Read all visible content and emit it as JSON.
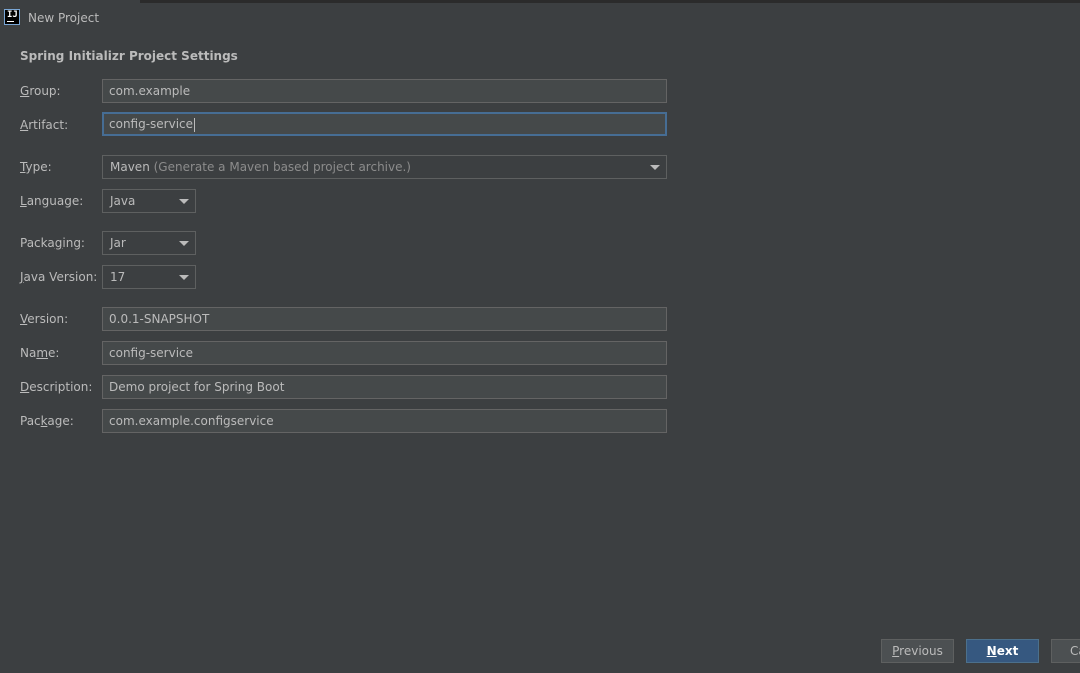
{
  "window": {
    "title": "New Project"
  },
  "form": {
    "section_title": "Spring Initializr Project Settings",
    "group": {
      "label_m": "G",
      "label_rest": "roup:",
      "value": "com.example"
    },
    "artifact": {
      "label_m": "A",
      "label_rest": "rtifact:",
      "value": "config-service"
    },
    "type": {
      "label_m": "T",
      "label_rest": "ype:",
      "value": "Maven",
      "hint": "(Generate a Maven based project archive.)"
    },
    "language": {
      "label_pre": "",
      "label_m": "L",
      "label_rest": "anguage:",
      "value": "Java"
    },
    "packaging": {
      "label_pre": "Packa",
      "label_m": "g",
      "label_rest": "ing:",
      "value": "Jar"
    },
    "java_version": {
      "label_m": "J",
      "label_rest": "ava Version:",
      "value": "17"
    },
    "version": {
      "label_m": "V",
      "label_rest": "ersion:",
      "value": "0.0.1-SNAPSHOT"
    },
    "name": {
      "label_pre": "Na",
      "label_m": "m",
      "label_rest": "e:",
      "value": "config-service"
    },
    "description": {
      "label_m": "D",
      "label_rest": "escription:",
      "value": "Demo project for Spring Boot"
    },
    "package": {
      "label_pre": "Pac",
      "label_m": "k",
      "label_rest": "age:",
      "value": "com.example.configservice"
    }
  },
  "buttons": {
    "previous": {
      "m": "P",
      "rest": "revious"
    },
    "next": {
      "m": "N",
      "rest": "ext"
    },
    "cancel": {
      "text": "Ca"
    }
  },
  "colors": {
    "background": "#3c3f41",
    "field_background": "#45494a",
    "focus_border": "#466d94",
    "primary_button": "#365880"
  },
  "icons": {
    "app": "intellij-idea-icon",
    "dropdown": "chevron-down-icon"
  }
}
